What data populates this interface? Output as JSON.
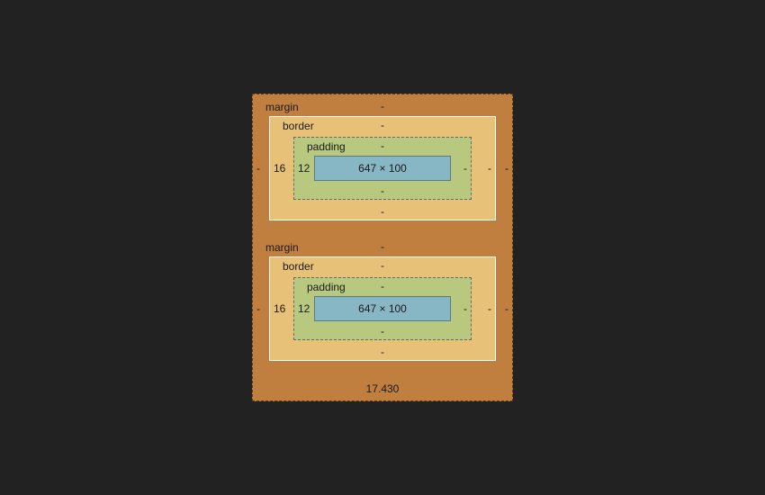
{
  "labels": {
    "margin": "margin",
    "border": "border",
    "padding": "padding"
  },
  "boxes": [
    {
      "margin": {
        "top": "-",
        "right": "-",
        "bottom": "-",
        "left": "-"
      },
      "border": {
        "top": "-",
        "right": "-",
        "bottom": "-",
        "left": "16"
      },
      "padding": {
        "top": "-",
        "right": "-",
        "bottom": "-",
        "left": "12"
      },
      "content": "647 × 100"
    },
    {
      "margin": {
        "top": "-",
        "right": "-",
        "bottom": "-",
        "left": "-"
      },
      "border": {
        "top": "-",
        "right": "-",
        "bottom": "-",
        "left": "16"
      },
      "padding": {
        "top": "-",
        "right": "-",
        "bottom": "-",
        "left": "12"
      },
      "content": "647 × 100"
    }
  ],
  "panel_bottom": "17.430"
}
